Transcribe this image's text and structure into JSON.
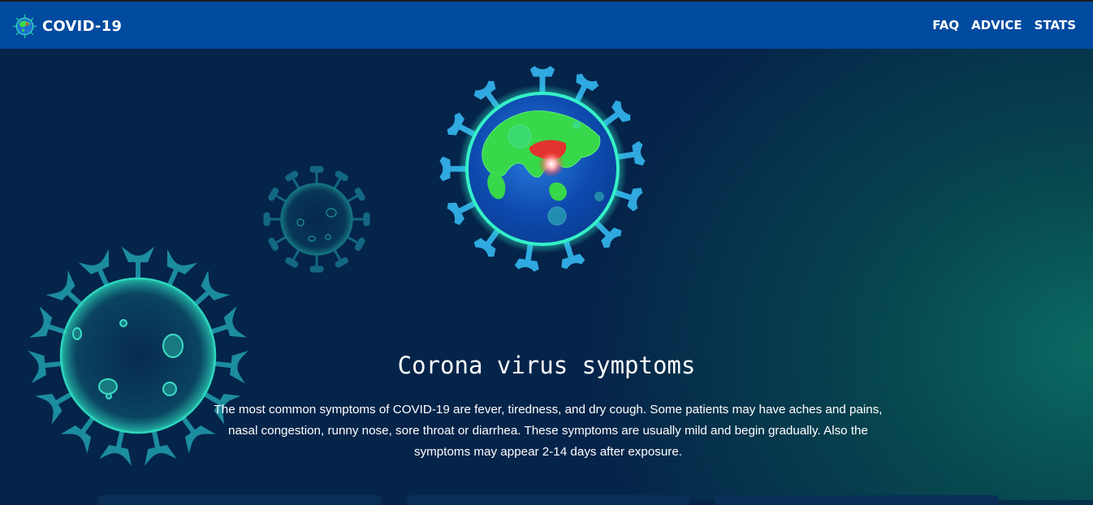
{
  "navbar": {
    "logo_icon": "virus-globe-icon",
    "brand": "COVID-19",
    "links": [
      "FAQ",
      "ADVICE",
      "STATS"
    ]
  },
  "hero": {
    "title": "Corona virus symptoms",
    "description": "The most common symptoms of COVID-19 are fever, tiredness, and dry cough. Some patients may have aches and pains, nasal congestion, runny nose, sore throat or diarrhea. These symptoms are usually mild and begin gradually. Also the symptoms may appear 2-14 days after exposure."
  },
  "colors": {
    "navbar": "#004a9f",
    "background": "#05244a",
    "accent_teal": "#0a6a62"
  }
}
